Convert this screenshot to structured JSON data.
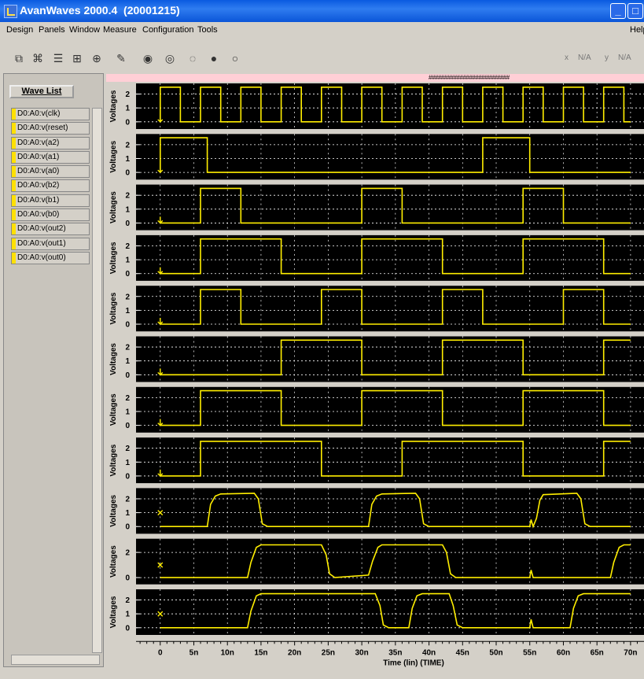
{
  "window": {
    "title": "AvanWaves 2000.4  (20001215)",
    "min": "_",
    "max": "□",
    "close": "X"
  },
  "menu": [
    {
      "label": "Design"
    },
    {
      "label": "Panels"
    },
    {
      "label": "Window"
    },
    {
      "label": "Measure"
    },
    {
      "label": "Configuration"
    },
    {
      "label": "Tools"
    },
    {
      "label": "Help"
    }
  ],
  "toolbar": {
    "x_label": "x",
    "x_value": "N/A",
    "y_label": "y",
    "y_value": "N/A"
  },
  "wave_list": {
    "button": "Wave List",
    "items": [
      "D0:A0:v(clk)",
      "D0:A0:v(reset)",
      "D0:A0:v(a2)",
      "D0:A0:v(a1)",
      "D0:A0:v(a0)",
      "D0:A0:v(b2)",
      "D0:A0:v(b1)",
      "D0:A0:v(b0)",
      "D0:A0:v(out2)",
      "D0:A0:v(out1)",
      "D0:A0:v(out0)"
    ]
  },
  "banner": "##########################",
  "colors": {
    "trace": "#ffee00",
    "plot_bg": "#000000",
    "grid": "#ffffff"
  },
  "chart_data": {
    "type": "line",
    "xlabel": "Time (lin) (TIME)",
    "ylabel": "Voltages",
    "x_ticks": [
      "0",
      "5n",
      "10n",
      "15n",
      "20n",
      "25n",
      "30n",
      "35n",
      "40n",
      "45n",
      "50n",
      "55n",
      "60n",
      "65n",
      "70n"
    ],
    "xlim": [
      -3.6,
      72
    ],
    "series": [
      {
        "name": "D0:A0:v(clk)",
        "y_ticks": [
          "2",
          "1",
          "0"
        ],
        "ylim": [
          -0.35,
          2.6
        ],
        "marker": "arrow",
        "points": [
          [
            0,
            0
          ],
          [
            0,
            2.5
          ],
          [
            3,
            2.5
          ],
          [
            3,
            0
          ],
          [
            6,
            0
          ],
          [
            6,
            2.5
          ],
          [
            9,
            2.5
          ],
          [
            9,
            0
          ],
          [
            12,
            0
          ],
          [
            12,
            2.5
          ],
          [
            15,
            2.5
          ],
          [
            15,
            0
          ],
          [
            18,
            0
          ],
          [
            18,
            2.5
          ],
          [
            21,
            2.5
          ],
          [
            21,
            0
          ],
          [
            24,
            0
          ],
          [
            24,
            2.5
          ],
          [
            27,
            2.5
          ],
          [
            27,
            0
          ],
          [
            30,
            0
          ],
          [
            30,
            2.5
          ],
          [
            33,
            2.5
          ],
          [
            33,
            0
          ],
          [
            36,
            0
          ],
          [
            36,
            2.5
          ],
          [
            39,
            2.5
          ],
          [
            39,
            0
          ],
          [
            42,
            0
          ],
          [
            42,
            2.5
          ],
          [
            45,
            2.5
          ],
          [
            45,
            0
          ],
          [
            48,
            0
          ],
          [
            48,
            2.5
          ],
          [
            51,
            2.5
          ],
          [
            51,
            0
          ],
          [
            54,
            0
          ],
          [
            54,
            2.5
          ],
          [
            57,
            2.5
          ],
          [
            57,
            0
          ],
          [
            60,
            0
          ],
          [
            60,
            2.5
          ],
          [
            63,
            2.5
          ],
          [
            63,
            0
          ],
          [
            66,
            0
          ],
          [
            66,
            2.5
          ],
          [
            69,
            2.5
          ],
          [
            69,
            0
          ],
          [
            70,
            0
          ]
        ]
      },
      {
        "name": "D0:A0:v(reset)",
        "y_ticks": [
          "2",
          "1",
          "0"
        ],
        "ylim": [
          -0.35,
          2.6
        ],
        "marker": "arrow",
        "points": [
          [
            0,
            0
          ],
          [
            0,
            2.5
          ],
          [
            7,
            2.5
          ],
          [
            7,
            0
          ],
          [
            48,
            0
          ],
          [
            48,
            2.5
          ],
          [
            55,
            2.5
          ],
          [
            55,
            0
          ],
          [
            70,
            0
          ]
        ]
      },
      {
        "name": "D0:A0:v(a2)",
        "y_ticks": [
          "2",
          "1",
          "0"
        ],
        "ylim": [
          -0.35,
          2.6
        ],
        "marker": "arrow",
        "points": [
          [
            0,
            0
          ],
          [
            6,
            0
          ],
          [
            6,
            2.5
          ],
          [
            12,
            2.5
          ],
          [
            12,
            0
          ],
          [
            30,
            0
          ],
          [
            30,
            2.5
          ],
          [
            36,
            2.5
          ],
          [
            36,
            0
          ],
          [
            54,
            0
          ],
          [
            54,
            2.5
          ],
          [
            60,
            2.5
          ],
          [
            60,
            0
          ],
          [
            70,
            0
          ]
        ]
      },
      {
        "name": "D0:A0:v(a1)",
        "y_ticks": [
          "2",
          "1",
          "0"
        ],
        "ylim": [
          -0.35,
          2.6
        ],
        "marker": "arrow",
        "points": [
          [
            0,
            0
          ],
          [
            6,
            0
          ],
          [
            6,
            2.5
          ],
          [
            18,
            2.5
          ],
          [
            18,
            0
          ],
          [
            30,
            0
          ],
          [
            30,
            2.5
          ],
          [
            42,
            2.5
          ],
          [
            42,
            0
          ],
          [
            54,
            0
          ],
          [
            54,
            2.5
          ],
          [
            66,
            2.5
          ],
          [
            66,
            0
          ],
          [
            70,
            0
          ]
        ]
      },
      {
        "name": "D0:A0:v(a0)",
        "y_ticks": [
          "2",
          "1",
          "0"
        ],
        "ylim": [
          -0.35,
          2.6
        ],
        "marker": "arrow",
        "points": [
          [
            0,
            0
          ],
          [
            6,
            0
          ],
          [
            6,
            2.5
          ],
          [
            12,
            2.5
          ],
          [
            12,
            0
          ],
          [
            24,
            0
          ],
          [
            24,
            2.5
          ],
          [
            30,
            2.5
          ],
          [
            30,
            0
          ],
          [
            42,
            0
          ],
          [
            42,
            2.5
          ],
          [
            48,
            2.5
          ],
          [
            48,
            0
          ],
          [
            60,
            0
          ],
          [
            60,
            2.5
          ],
          [
            66,
            2.5
          ],
          [
            66,
            0
          ],
          [
            70,
            0
          ]
        ]
      },
      {
        "name": "D0:A0:v(b2)",
        "y_ticks": [
          "2",
          "1",
          "0"
        ],
        "ylim": [
          -0.35,
          2.6
        ],
        "marker": "arrow",
        "points": [
          [
            0,
            0
          ],
          [
            18,
            0
          ],
          [
            18,
            2.5
          ],
          [
            30,
            2.5
          ],
          [
            30,
            0
          ],
          [
            42,
            0
          ],
          [
            42,
            2.5
          ],
          [
            54,
            2.5
          ],
          [
            54,
            0
          ],
          [
            66,
            0
          ],
          [
            66,
            2.5
          ],
          [
            70,
            2.5
          ]
        ]
      },
      {
        "name": "D0:A0:v(b1)",
        "y_ticks": [
          "2",
          "1",
          "0"
        ],
        "ylim": [
          -0.35,
          2.6
        ],
        "marker": "arrow",
        "points": [
          [
            0,
            0
          ],
          [
            6,
            0
          ],
          [
            6,
            2.5
          ],
          [
            18,
            2.5
          ],
          [
            18,
            0
          ],
          [
            30,
            0
          ],
          [
            30,
            2.5
          ],
          [
            42,
            2.5
          ],
          [
            42,
            0
          ],
          [
            54,
            0
          ],
          [
            54,
            2.5
          ],
          [
            66,
            2.5
          ],
          [
            66,
            0
          ],
          [
            70,
            0
          ]
        ]
      },
      {
        "name": "D0:A0:v(b0)",
        "y_ticks": [
          "2",
          "1",
          "0"
        ],
        "ylim": [
          -0.35,
          2.6
        ],
        "marker": "arrow",
        "points": [
          [
            0,
            0
          ],
          [
            6,
            0
          ],
          [
            6,
            2.5
          ],
          [
            24,
            2.5
          ],
          [
            24,
            0
          ],
          [
            36,
            0
          ],
          [
            36,
            2.5
          ],
          [
            54,
            2.5
          ],
          [
            54,
            0
          ],
          [
            66,
            0
          ],
          [
            66,
            2.5
          ],
          [
            70,
            2.5
          ]
        ]
      },
      {
        "name": "D0:A0:v(out2)",
        "y_ticks": [
          "2",
          "1",
          "0"
        ],
        "ylim": [
          -0.35,
          2.6
        ],
        "marker": "cross",
        "points": [
          [
            0,
            0
          ],
          [
            7,
            0
          ],
          [
            7.5,
            1.6
          ],
          [
            8.2,
            2.2
          ],
          [
            9,
            2.35
          ],
          [
            14,
            2.4
          ],
          [
            14.6,
            2.0
          ],
          [
            15.2,
            0.2
          ],
          [
            16,
            0
          ],
          [
            31,
            0
          ],
          [
            31.5,
            1.6
          ],
          [
            32.2,
            2.2
          ],
          [
            33,
            2.35
          ],
          [
            38,
            2.4
          ],
          [
            38.6,
            2.0
          ],
          [
            39.2,
            0.2
          ],
          [
            40,
            0
          ],
          [
            55,
            0
          ],
          [
            55.2,
            0.5
          ],
          [
            55.5,
            0
          ],
          [
            56,
            0.6
          ],
          [
            56.5,
            1.9
          ],
          [
            57,
            2.3
          ],
          [
            62,
            2.4
          ],
          [
            62.6,
            2.0
          ],
          [
            63.2,
            0.2
          ],
          [
            64,
            0
          ],
          [
            70,
            0
          ]
        ]
      },
      {
        "name": "D0:A0:v(out1)",
        "y_ticks": [
          "2",
          "0"
        ],
        "ylim": [
          -0.35,
          2.9
        ],
        "marker": "cross",
        "points": [
          [
            0,
            0
          ],
          [
            13,
            0
          ],
          [
            13.5,
            1.2
          ],
          [
            14.3,
            2.4
          ],
          [
            15,
            2.6
          ],
          [
            24,
            2.6
          ],
          [
            24.7,
            1.8
          ],
          [
            25.2,
            0.3
          ],
          [
            26,
            0
          ],
          [
            31,
            0.2
          ],
          [
            31.6,
            1.3
          ],
          [
            32.4,
            2.4
          ],
          [
            33,
            2.6
          ],
          [
            42,
            2.6
          ],
          [
            42.6,
            2.0
          ],
          [
            43.2,
            0.3
          ],
          [
            44,
            0
          ],
          [
            55,
            0
          ],
          [
            55.2,
            0.6
          ],
          [
            55.5,
            0
          ],
          [
            67,
            0
          ],
          [
            67.5,
            1.2
          ],
          [
            68.3,
            2.4
          ],
          [
            69,
            2.6
          ],
          [
            70,
            2.6
          ]
        ]
      },
      {
        "name": "D0:A0:v(out0)",
        "y_ticks": [
          "2",
          "1",
          "0"
        ],
        "ylim": [
          -0.35,
          2.6
        ],
        "marker": "cross",
        "points": [
          [
            0,
            0
          ],
          [
            13,
            0
          ],
          [
            13.5,
            1.2
          ],
          [
            14.3,
            2.3
          ],
          [
            15,
            2.45
          ],
          [
            32,
            2.45
          ],
          [
            32.7,
            1.6
          ],
          [
            33.2,
            0.2
          ],
          [
            34,
            0
          ],
          [
            37,
            0
          ],
          [
            37.5,
            1.4
          ],
          [
            38.2,
            2.3
          ],
          [
            39,
            2.45
          ],
          [
            43,
            2.45
          ],
          [
            43.6,
            1.6
          ],
          [
            44.2,
            0.2
          ],
          [
            45,
            0
          ],
          [
            55,
            0
          ],
          [
            55.2,
            0.6
          ],
          [
            55.5,
            0
          ],
          [
            61,
            0
          ],
          [
            61.5,
            1.4
          ],
          [
            62.2,
            2.3
          ],
          [
            63,
            2.45
          ],
          [
            70,
            2.45
          ]
        ]
      }
    ]
  }
}
